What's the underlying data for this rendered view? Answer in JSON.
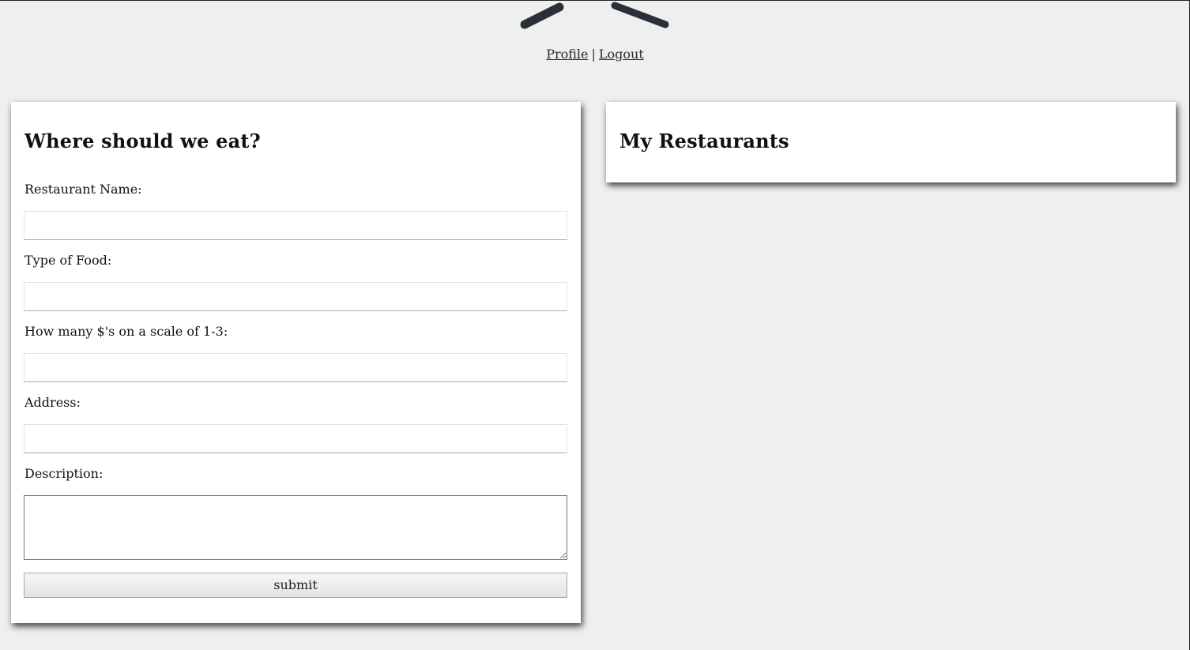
{
  "nav": {
    "profile_label": "Profile",
    "separator": "|",
    "logout_label": "Logout"
  },
  "form": {
    "title": "Where should we eat?",
    "fields": [
      {
        "label": "Restaurant Name:",
        "value": ""
      },
      {
        "label": "Type of Food:",
        "value": ""
      },
      {
        "label": "How many $'s on a scale of 1-3:",
        "value": ""
      },
      {
        "label": "Address:",
        "value": ""
      },
      {
        "label": "Description:",
        "value": ""
      }
    ],
    "submit_label": "submit"
  },
  "restaurants": {
    "title": "My Restaurants"
  },
  "colors": {
    "background": "#eef0ef",
    "card": "#ffffff",
    "logo": "#2b2f38"
  },
  "icons": {
    "logo": "crossed-utensils-icon"
  }
}
